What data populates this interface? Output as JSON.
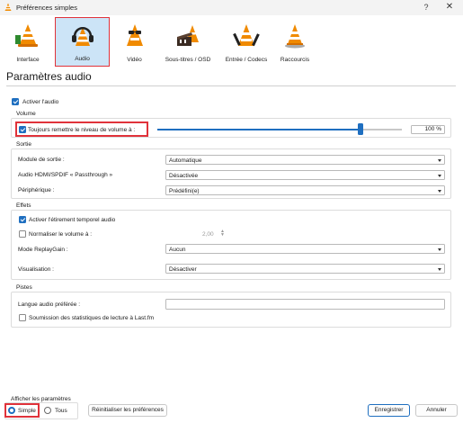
{
  "window": {
    "title": "Préférences simples",
    "help_label": "?",
    "close_label": "✕"
  },
  "tabs": [
    {
      "label": "Interface",
      "icon": "cone-icon"
    },
    {
      "label": "Audio",
      "icon": "headphones-cone-icon"
    },
    {
      "label": "Vidéo",
      "icon": "cone-glasses-icon"
    },
    {
      "label": "Sous-titres / OSD",
      "icon": "clapper-cone-icon"
    },
    {
      "label": "Entrée / Codecs",
      "icon": "cone-tools-icon"
    },
    {
      "label": "Raccourcis",
      "icon": "cone-stack-icon"
    }
  ],
  "active_tab": "Audio",
  "page_title": "Paramètres audio",
  "enable_audio": {
    "label": "Activer l'audio",
    "checked": true
  },
  "volume": {
    "group_label": "Volume",
    "always_reset_label": "Toujours remettre le niveau de volume à :",
    "always_reset_checked": true,
    "level_fraction": 0.83,
    "percent_text": "100 %"
  },
  "output": {
    "group_label": "Sortie",
    "module_label": "Module de sortie :",
    "module_value": "Automatique",
    "hdmi_label": "Audio HDMI/SPDIF « Passthrough »",
    "hdmi_value": "Désactivée",
    "device_label": "Périphérique :",
    "device_value": "Prédéfini(e)"
  },
  "effects": {
    "group_label": "Effets",
    "timestretch_label": "Activer l'étirement temporel audio",
    "timestretch_checked": true,
    "normalize_label": "Normaliser le volume à :",
    "normalize_checked": false,
    "normalize_value": "2,00",
    "replaygain_label": "Mode ReplayGain :",
    "replaygain_value": "Aucun",
    "visualization_label": "Visualisation :",
    "visualization_value": "Désactiver"
  },
  "tracks": {
    "group_label": "Pistes",
    "preferred_lang_label": "Langue audio préférée :",
    "preferred_lang_value": "",
    "lastfm_label": "Soumission des statistiques de lecture à Last.fm",
    "lastfm_checked": false
  },
  "footer": {
    "show_settings_label": "Afficher les paramètres",
    "simple_label": "Simple",
    "all_label": "Tous",
    "reset_label": "Réinitialiser les préférences",
    "save_label": "Enregistrer",
    "cancel_label": "Annuler"
  },
  "colors": {
    "accent": "#1f6fc0",
    "highlight": "#e0323a",
    "active_tab_bg": "#cce4f7"
  }
}
